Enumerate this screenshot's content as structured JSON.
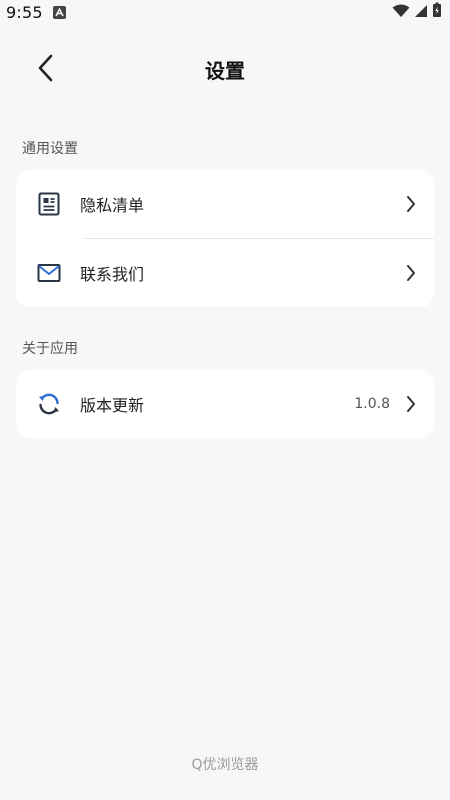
{
  "status_bar": {
    "time": "9:55",
    "notification_icon": "a-icon",
    "wifi_icon": "wifi-icon",
    "signal_icon": "signal-icon",
    "battery_icon": "battery-charging-icon"
  },
  "header": {
    "title": "设置",
    "back_icon": "chevron-left-icon"
  },
  "sections": {
    "general": {
      "title": "通用设置",
      "items": [
        {
          "label": "隐私清单",
          "icon": "document-list-icon"
        },
        {
          "label": "联系我们",
          "icon": "mail-icon"
        }
      ]
    },
    "about": {
      "title": "关于应用",
      "items": [
        {
          "label": "版本更新",
          "value": "1.0.8",
          "icon": "refresh-icon"
        }
      ]
    }
  },
  "footer": {
    "brand": "Q优浏览器"
  },
  "colors": {
    "background": "#f6f7f9",
    "card": "#ffffff",
    "icon_accent": "#2f6fd6",
    "icon_dark": "#2a3545"
  }
}
